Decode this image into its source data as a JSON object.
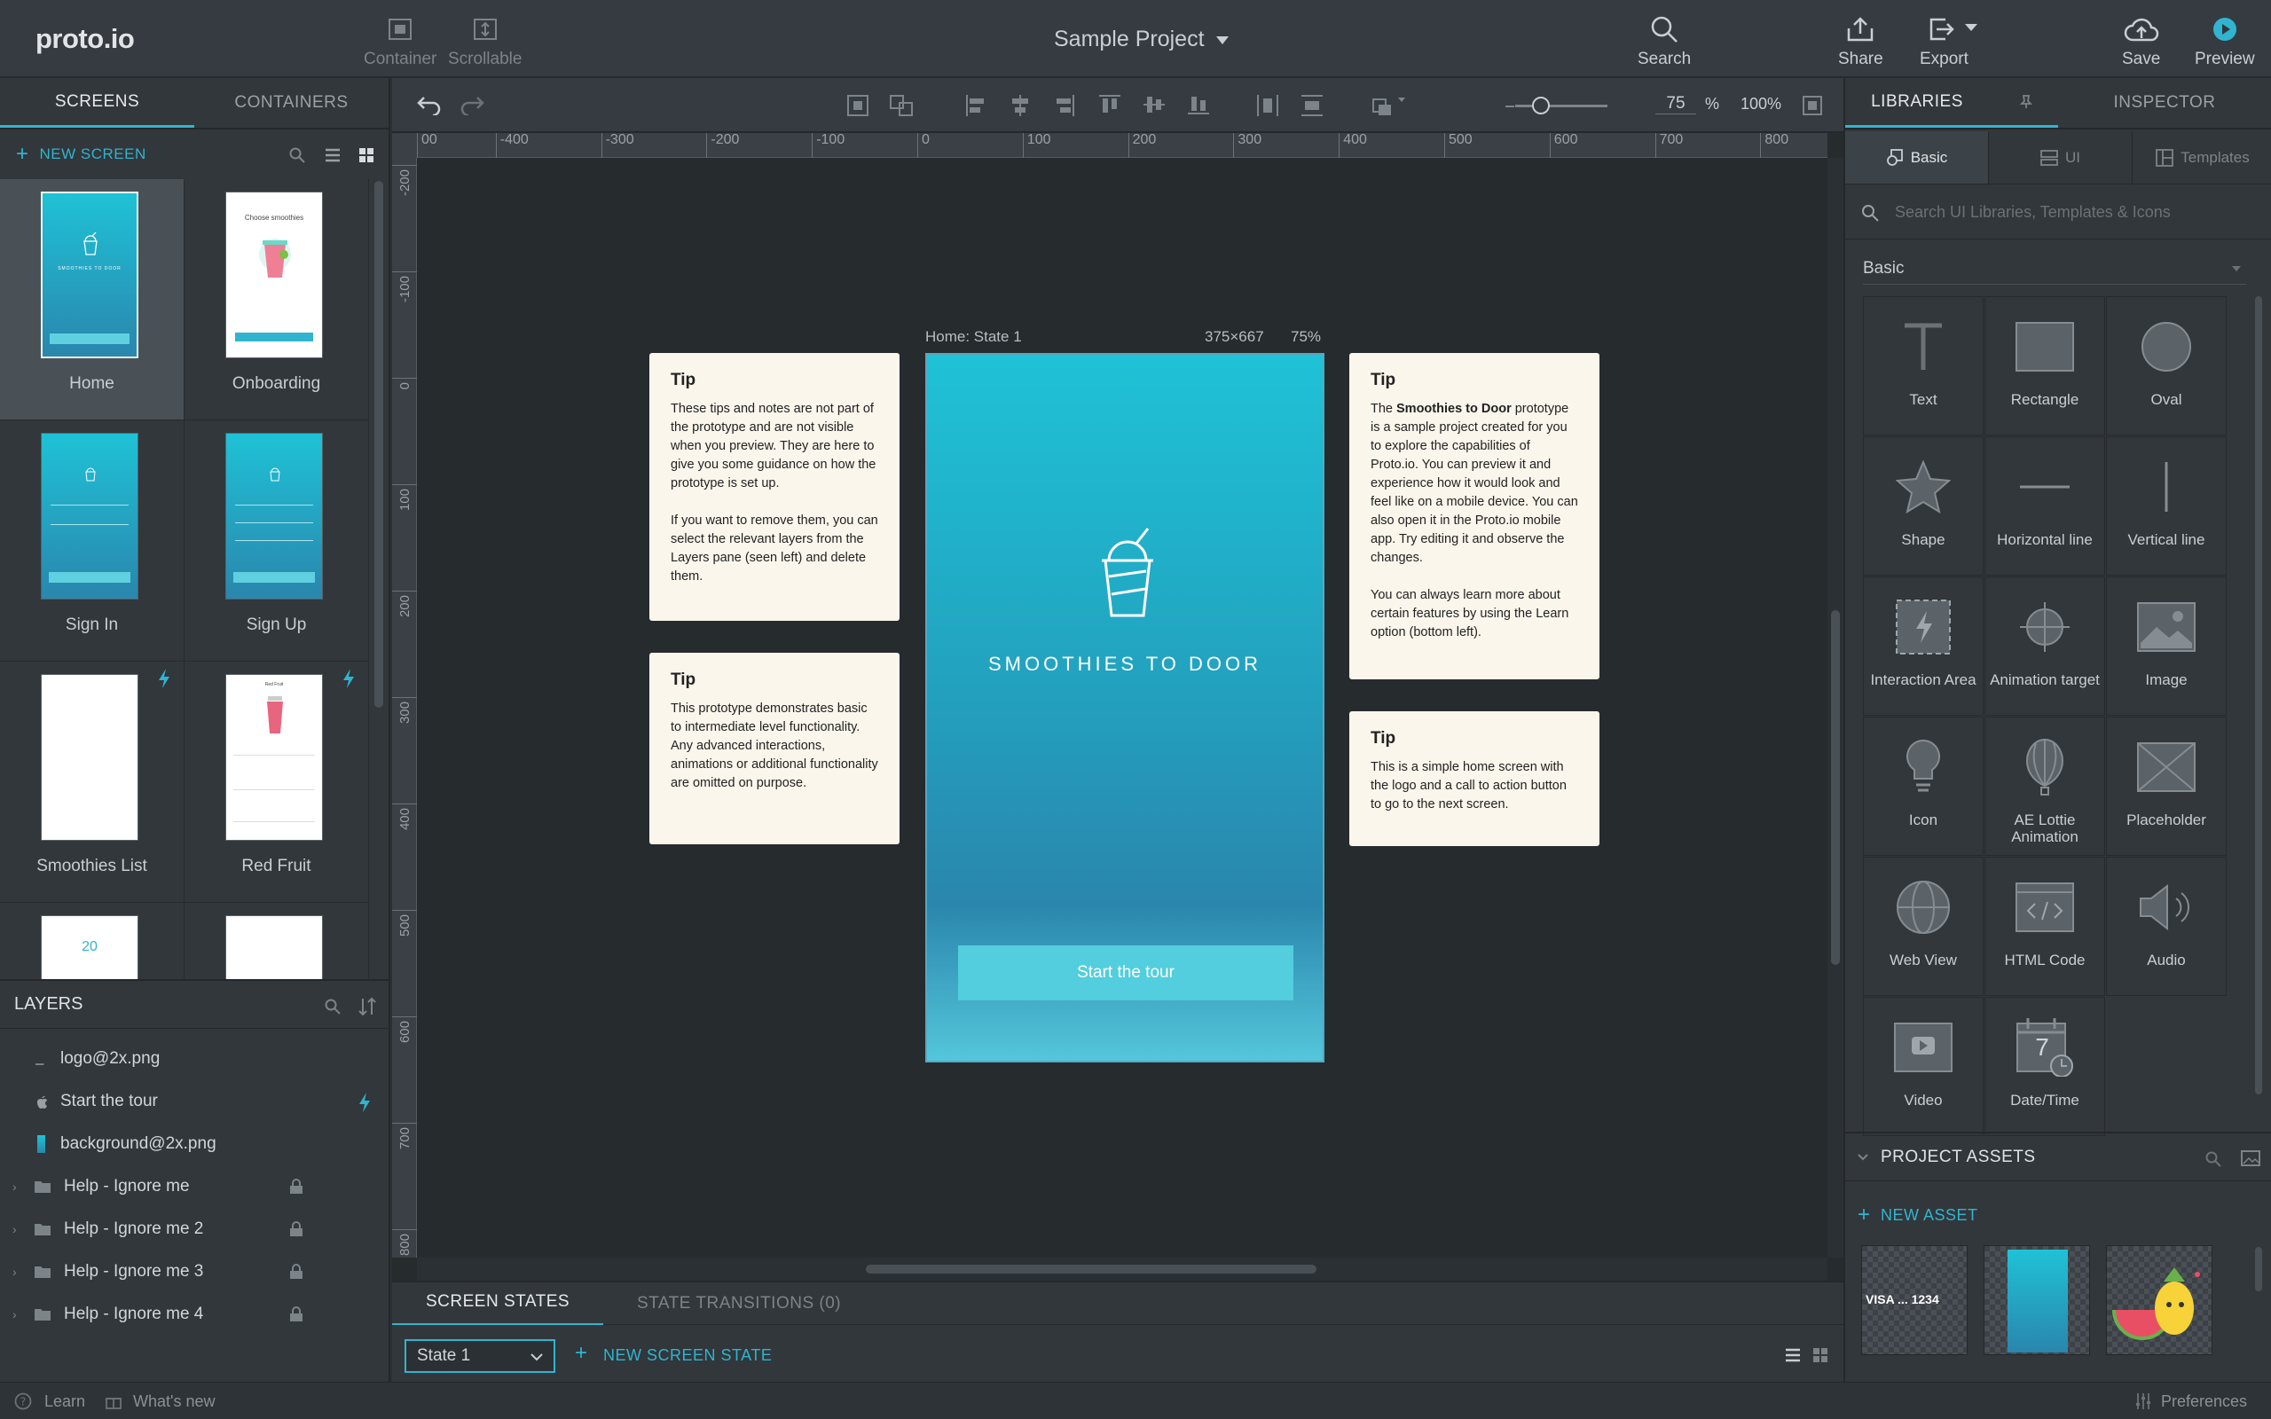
{
  "app": {
    "logo": "proto.io",
    "project": "Sample Project"
  },
  "topbar": {
    "container": "Container",
    "scrollable": "Scrollable",
    "search": "Search",
    "share": "Share",
    "export": "Export",
    "save": "Save",
    "preview": "Preview"
  },
  "left": {
    "tabs": [
      "SCREENS",
      "CONTAINERS"
    ],
    "new_screen": "NEW SCREEN",
    "screens": [
      "Home",
      "Onboarding",
      "Sign In",
      "Sign Up",
      "Smoothies List",
      "Red Fruit"
    ],
    "thumb_texts": {
      "brand": "SMOOTHIES TO DOOR",
      "onboarding": "Choose smoothies",
      "red_fruit": "Red Fruit",
      "counter": "20"
    },
    "layers_title": "LAYERS",
    "layers": [
      "logo@2x.png",
      "Start the tour",
      "background@2x.png",
      "Help - Ignore me",
      "Help - Ignore me 2",
      "Help - Ignore me 3",
      "Help - Ignore me 4"
    ]
  },
  "toolbar": {
    "zoom_value": "75",
    "zoom_unit": "%",
    "zoom_fit": "100%"
  },
  "ruler": {
    "h": [
      "00",
      "-400",
      "-300",
      "-200",
      "-100",
      "0",
      "100",
      "200",
      "300",
      "400",
      "500",
      "600",
      "700",
      "800"
    ],
    "v": [
      "-200",
      "-100",
      "0",
      "100",
      "200",
      "300",
      "400",
      "500",
      "600",
      "700",
      "800"
    ]
  },
  "canvas": {
    "screen_label": "Home: State 1",
    "screen_size": "375×667",
    "screen_zoom": "75%",
    "brand": "SMOOTHIES TO DOOR",
    "cta": "Start the tour"
  },
  "tips": {
    "t1": {
      "title": "Tip",
      "p1": "These tips and notes are not part of the prototype and are not visible when you preview. They are here to give you some guidance on how the prototype is set up.",
      "p2": "If you want to remove them, you can select the relevant layers from the Layers pane (seen left) and delete them."
    },
    "t2": {
      "title": "Tip",
      "p1": "This prototype demonstrates basic to intermediate level functionality. Any advanced interactions, animations or additional functionality are omitted on purpose."
    },
    "t3": {
      "title": "Tip",
      "pre": "The ",
      "bold": "Smoothies to Door",
      "post": " prototype is a sample project created for you to explore the capabilities of Proto.io. You can preview it and experience how it would look and feel like on a mobile device. You can also open it in the Proto.io mobile app. Try editing it and observe the changes.",
      "p2": "You can always learn more about certain features by using the Learn option (bottom left)."
    },
    "t4": {
      "title": "Tip",
      "p1": "This is a simple home screen with the logo and a call to action button to go to the next screen."
    }
  },
  "bottom": {
    "tab1": "SCREEN STATES",
    "tab2": "STATE TRANSITIONS (0)",
    "state": "State 1",
    "new_state": "NEW SCREEN STATE"
  },
  "right": {
    "tabs": [
      "LIBRARIES",
      "INSPECTOR"
    ],
    "subtabs": [
      "Basic",
      "UI",
      "Templates"
    ],
    "search_placeholder": "Search UI Libraries, Templates & Icons",
    "section": "Basic",
    "items": [
      "Text",
      "Rectangle",
      "Oval",
      "Shape",
      "Horizontal line",
      "Vertical line",
      "Interaction Area",
      "Animation target",
      "Image",
      "Icon",
      "AE Lottie Animation",
      "Placeholder",
      "Web View",
      "HTML Code",
      "Audio",
      "Video",
      "Date/Time"
    ],
    "assets_title": "PROJECT ASSETS",
    "new_asset": "NEW ASSET",
    "card_text": "VISA  ... 1234",
    "calendar_day": "7"
  },
  "status": {
    "learn": "Learn",
    "whats_new": "What's new",
    "preferences": "Preferences"
  },
  "colors": {
    "accent": "#31b4cf",
    "panel": "#31373b",
    "canvas": "#262b2e",
    "tip_bg": "#faf6ec"
  }
}
